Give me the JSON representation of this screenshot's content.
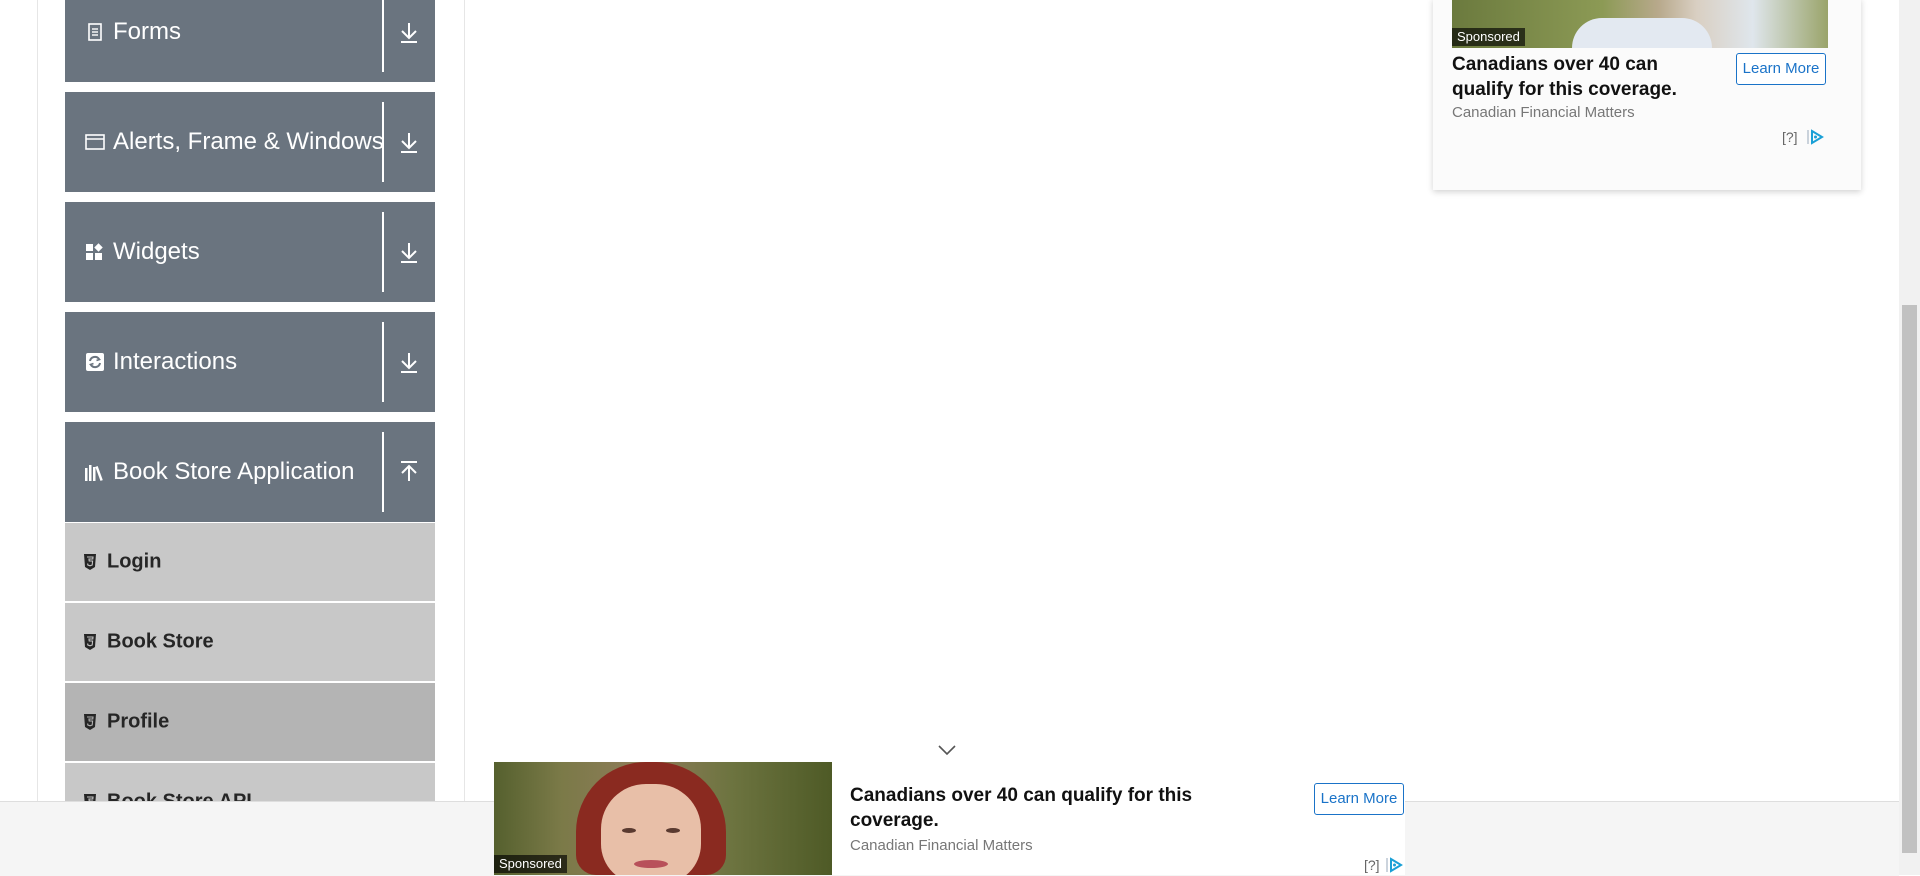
{
  "sidebar": {
    "groups": [
      {
        "label": "Forms",
        "icon": "document-icon",
        "expanded": false
      },
      {
        "label": "Alerts, Frame & Windows",
        "icon": "window-icon",
        "expanded": false
      },
      {
        "label": "Widgets",
        "icon": "widgets-icon",
        "expanded": false
      },
      {
        "label": "Interactions",
        "icon": "interactions-icon",
        "expanded": false
      },
      {
        "label": "Book Store Application",
        "icon": "books-icon",
        "expanded": true
      }
    ],
    "book_store_items": [
      {
        "label": "Login",
        "icon": "html5-icon",
        "active": false
      },
      {
        "label": "Book Store",
        "icon": "html5-icon",
        "active": false
      },
      {
        "label": "Profile",
        "icon": "html5-icon",
        "active": true
      },
      {
        "label": "Book Store API",
        "icon": "html5-icon",
        "active": false
      }
    ]
  },
  "ad_top": {
    "sponsored": "Sponsored",
    "headline": "Canadians over 40 can qualify for this coverage.",
    "source": "Canadian Financial Matters",
    "cta": "Learn More",
    "help": "[?]"
  },
  "ad_bottom": {
    "sponsored": "Sponsored",
    "headline": "Canadians over 40 can qualify for this coverage.",
    "source": "Canadian Financial Matters",
    "cta": "Learn More",
    "help": "[?]"
  },
  "colors": {
    "group_header_bg": "#6a747f",
    "sub_item_bg": "#c8c8c8",
    "sub_item_active_bg": "#b4b4b4",
    "ad_accent": "#1a73c8"
  }
}
